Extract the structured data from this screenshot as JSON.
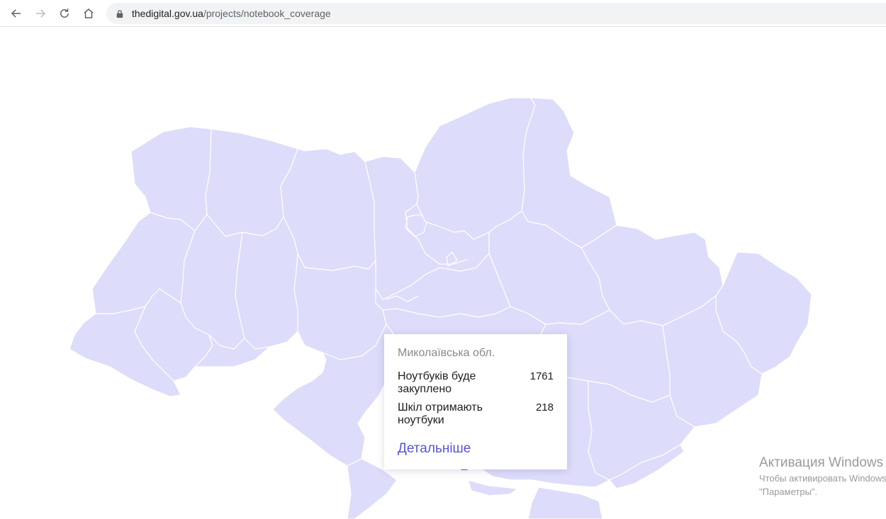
{
  "browser": {
    "url_host": "thedigital.gov.ua",
    "url_path": "/projects/notebook_coverage"
  },
  "tooltip": {
    "region": "Миколаївська обл.",
    "rows": [
      {
        "label": "Ноутбуків буде закуплено",
        "value": "1761"
      },
      {
        "label": "Шкіл отримають ноутбуки",
        "value": "218"
      }
    ],
    "link": "Детальніше"
  },
  "watermark": {
    "title": "Активация Windows",
    "line1": "Чтобы активировать Windows,",
    "line2": "\"Параметры\"."
  },
  "colors": {
    "region_fill": "#dddcfa",
    "accent": "#5a55d6"
  }
}
